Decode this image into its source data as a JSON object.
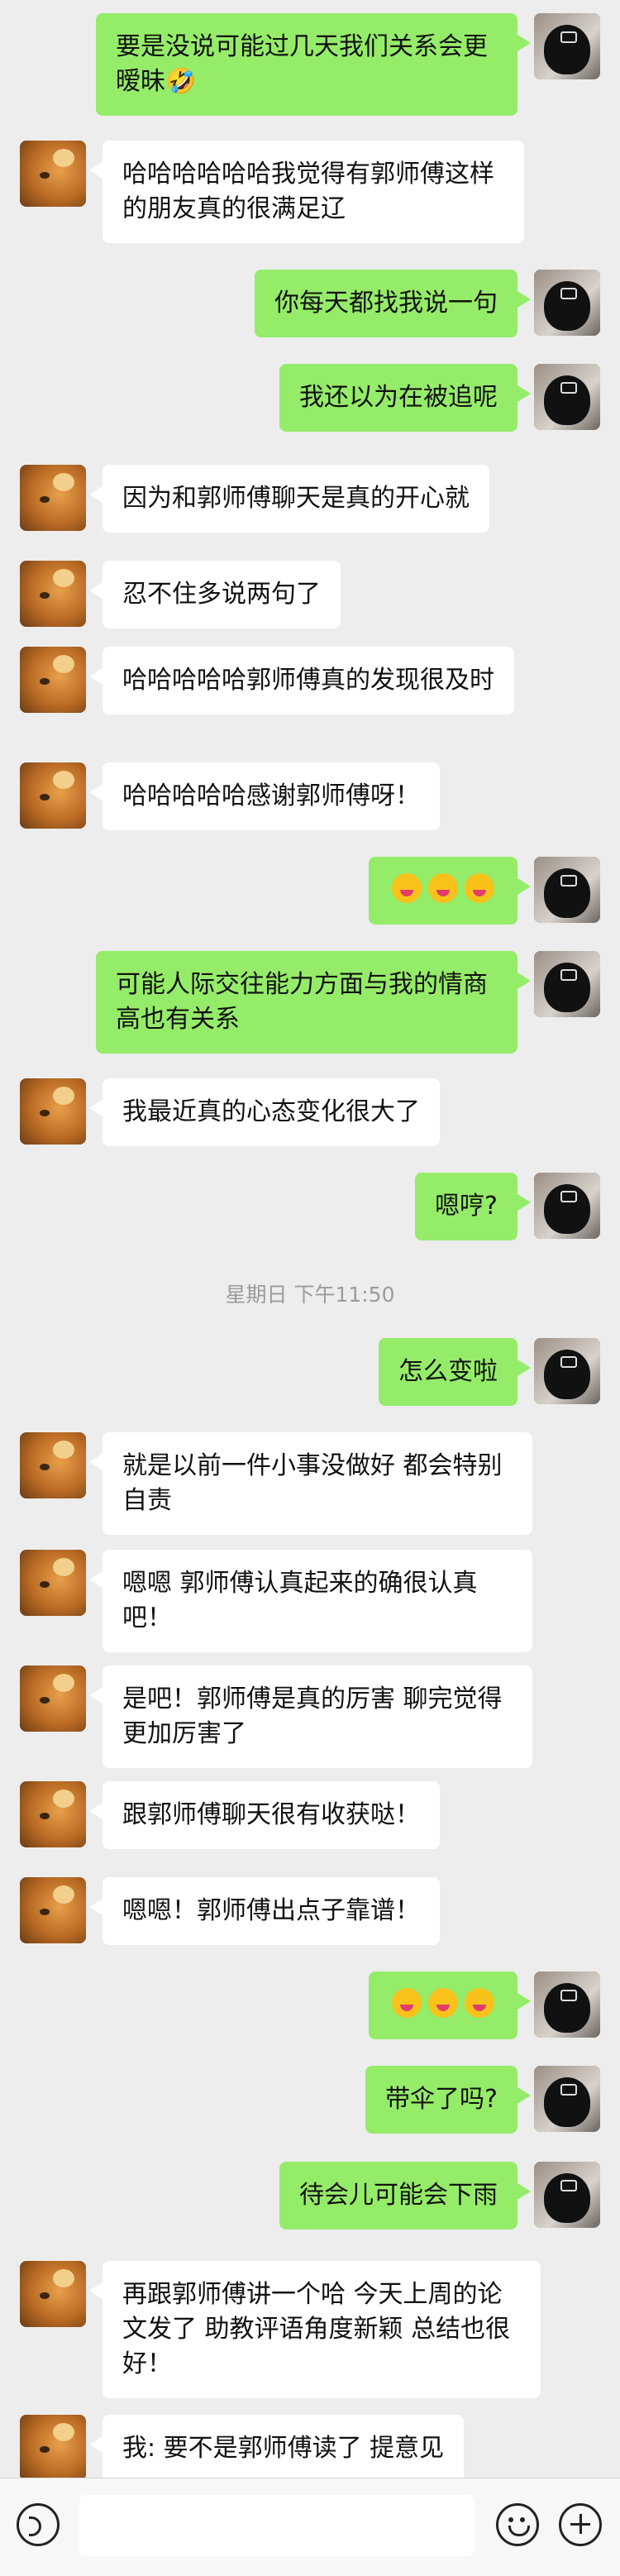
{
  "messages": [
    {
      "side": "me",
      "text": "要是没说可能过几天我们关系会更暧昧🤣"
    },
    {
      "side": "other",
      "text": "哈哈哈哈哈哈我觉得有郭师傅这样的朋友真的很满足辽"
    },
    {
      "side": "me",
      "text": "你每天都找我说一句"
    },
    {
      "side": "me",
      "text": "我还以为在被追呢"
    },
    {
      "side": "other",
      "text": "因为和郭师傅聊天是真的开心就"
    },
    {
      "side": "other",
      "text": "忍不住多说两句了"
    },
    {
      "side": "other",
      "text": "哈哈哈哈哈郭师傅真的发现很及时"
    },
    {
      "side": "other",
      "text": "哈哈哈哈哈感谢郭师傅呀！"
    },
    {
      "side": "me",
      "text": "😝😝😝"
    },
    {
      "side": "me",
      "text": "可能人际交往能力方面与我的情商高也有关系"
    },
    {
      "side": "other",
      "text": "我最近真的心态变化很大了"
    },
    {
      "side": "me",
      "text": "嗯哼?"
    },
    {
      "side": "me",
      "text": "怎么变啦"
    },
    {
      "side": "other",
      "text": "就是以前一件小事没做好 都会特别自责"
    },
    {
      "side": "other",
      "text": "嗯嗯 郭师傅认真起来的确很认真吧！"
    },
    {
      "side": "other",
      "text": "是吧！郭师傅是真的厉害 聊完觉得更加厉害了"
    },
    {
      "side": "other",
      "text": "跟郭师傅聊天很有收获哒！"
    },
    {
      "side": "other",
      "text": "嗯嗯！郭师傅出点子靠谱！"
    },
    {
      "side": "me",
      "text": "😝😝😝"
    },
    {
      "side": "me",
      "text": "带伞了吗?"
    },
    {
      "side": "me",
      "text": "待会儿可能会下雨"
    },
    {
      "side": "other",
      "text": "再跟郭师傅讲一个哈 今天上周的论文发了 助教评语角度新颖 总结也很好！"
    },
    {
      "side": "other",
      "text": "我: 要不是郭师傅读了 提意见"
    }
  ],
  "timestamp": "星期日 下午11:50",
  "input": {
    "value": ""
  },
  "icons": {
    "voice": "voice-icon",
    "emoji": "emoji-icon",
    "plus": "plus-icon"
  }
}
